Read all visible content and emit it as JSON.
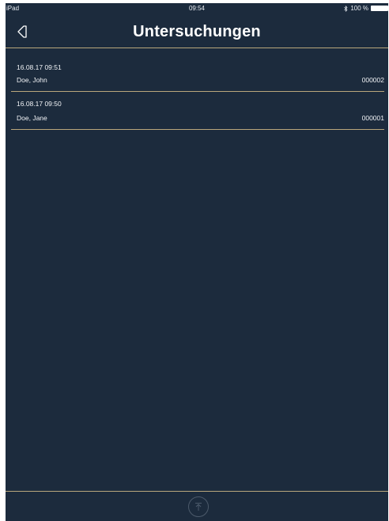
{
  "status_bar": {
    "device": "iPad",
    "time": "09:54",
    "battery_text": "100 %",
    "battery_level": 1.0
  },
  "nav": {
    "title": "Untersuchungen",
    "back_icon": "back-arrow-icon"
  },
  "examinations": [
    {
      "datetime": "16.08.17 09:51",
      "patient": "Doe, John",
      "id": "000002"
    },
    {
      "datetime": "16.08.17 09:50",
      "patient": "Doe, Jane",
      "id": "000001"
    }
  ],
  "toolbar": {
    "upload_icon": "upload-icon"
  },
  "colors": {
    "background": "#1c2b3d",
    "divider": "#b9a67c",
    "text": "#ffffff"
  }
}
